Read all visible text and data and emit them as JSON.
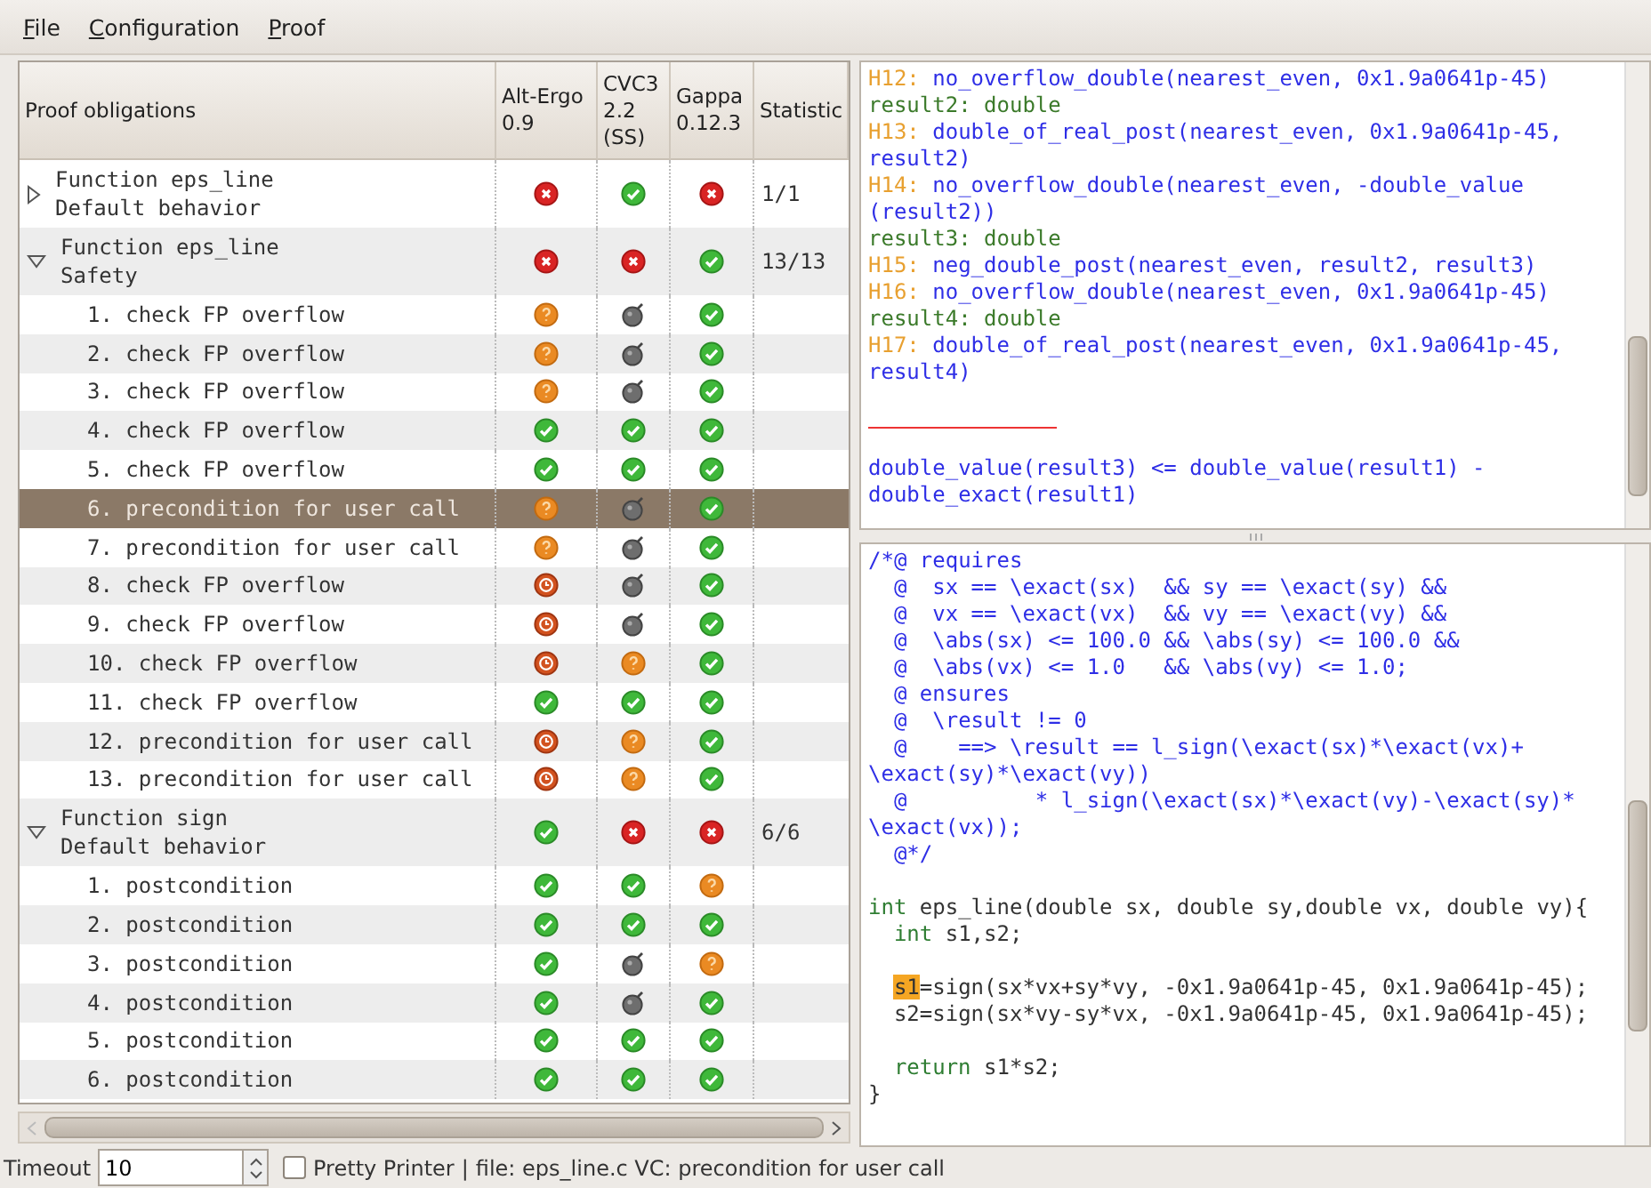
{
  "menu": [
    "File",
    "Configuration",
    "Proof"
  ],
  "tree": {
    "columns": [
      {
        "lines": [
          "Proof obligations"
        ]
      },
      {
        "lines": [
          "Alt-Ergo",
          "0.9"
        ]
      },
      {
        "lines": [
          "CVC3",
          "2.2",
          "(SS)"
        ]
      },
      {
        "lines": [
          "Gappa",
          "0.12.3"
        ]
      },
      {
        "lines": [
          "Statistic"
        ]
      }
    ],
    "groups": [
      {
        "label": [
          "Function eps_line",
          "Default behavior"
        ],
        "expanded": false,
        "selected": false,
        "results": [
          {
            "kind": "invalid"
          },
          {
            "kind": "valid"
          },
          {
            "kind": "invalid"
          }
        ],
        "statistic": "1/1"
      },
      {
        "label": [
          "Function eps_line",
          "Safety"
        ],
        "expanded": true,
        "selected": false,
        "results": [
          {
            "kind": "invalid"
          },
          {
            "kind": "invalid"
          },
          {
            "kind": "valid"
          }
        ],
        "statistic": "13/13",
        "children": [
          {
            "label": "1. check FP overflow",
            "selected": false,
            "results": [
              {
                "kind": "unknown"
              },
              {
                "kind": "error"
              },
              {
                "kind": "valid"
              }
            ]
          },
          {
            "label": "2. check FP overflow",
            "selected": false,
            "results": [
              {
                "kind": "unknown"
              },
              {
                "kind": "error"
              },
              {
                "kind": "valid"
              }
            ]
          },
          {
            "label": "3. check FP overflow",
            "selected": false,
            "results": [
              {
                "kind": "unknown"
              },
              {
                "kind": "error"
              },
              {
                "kind": "valid"
              }
            ]
          },
          {
            "label": "4. check FP overflow",
            "selected": false,
            "results": [
              {
                "kind": "valid"
              },
              {
                "kind": "valid"
              },
              {
                "kind": "valid"
              }
            ]
          },
          {
            "label": "5. check FP overflow",
            "selected": false,
            "results": [
              {
                "kind": "valid"
              },
              {
                "kind": "valid"
              },
              {
                "kind": "valid"
              }
            ]
          },
          {
            "label": "6. precondition for user call",
            "selected": true,
            "results": [
              {
                "kind": "unknown"
              },
              {
                "kind": "error"
              },
              {
                "kind": "valid"
              }
            ]
          },
          {
            "label": "7. precondition for user call",
            "selected": false,
            "results": [
              {
                "kind": "unknown"
              },
              {
                "kind": "error"
              },
              {
                "kind": "valid"
              }
            ]
          },
          {
            "label": "8. check FP overflow",
            "selected": false,
            "results": [
              {
                "kind": "timeout"
              },
              {
                "kind": "error"
              },
              {
                "kind": "valid"
              }
            ]
          },
          {
            "label": "9. check FP overflow",
            "selected": false,
            "results": [
              {
                "kind": "timeout"
              },
              {
                "kind": "error"
              },
              {
                "kind": "valid"
              }
            ]
          },
          {
            "label": "10. check FP overflow",
            "selected": false,
            "results": [
              {
                "kind": "timeout"
              },
              {
                "kind": "unknown"
              },
              {
                "kind": "valid"
              }
            ]
          },
          {
            "label": "11. check FP overflow",
            "selected": false,
            "results": [
              {
                "kind": "valid"
              },
              {
                "kind": "valid"
              },
              {
                "kind": "valid"
              }
            ]
          },
          {
            "label": "12. precondition for user call",
            "selected": false,
            "results": [
              {
                "kind": "timeout"
              },
              {
                "kind": "unknown"
              },
              {
                "kind": "valid"
              }
            ]
          },
          {
            "label": "13. precondition for user call",
            "selected": false,
            "results": [
              {
                "kind": "timeout"
              },
              {
                "kind": "unknown"
              },
              {
                "kind": "valid"
              }
            ]
          }
        ]
      },
      {
        "label": [
          "Function sign",
          "Default behavior"
        ],
        "expanded": true,
        "selected": false,
        "results": [
          {
            "kind": "valid"
          },
          {
            "kind": "invalid"
          },
          {
            "kind": "invalid"
          }
        ],
        "statistic": "6/6",
        "children": [
          {
            "label": "1. postcondition",
            "selected": false,
            "results": [
              {
                "kind": "valid"
              },
              {
                "kind": "valid"
              },
              {
                "kind": "unknown"
              }
            ]
          },
          {
            "label": "2. postcondition",
            "selected": false,
            "results": [
              {
                "kind": "valid"
              },
              {
                "kind": "valid"
              },
              {
                "kind": "valid"
              }
            ]
          },
          {
            "label": "3. postcondition",
            "selected": false,
            "results": [
              {
                "kind": "valid"
              },
              {
                "kind": "error"
              },
              {
                "kind": "unknown"
              }
            ]
          },
          {
            "label": "4. postcondition",
            "selected": false,
            "results": [
              {
                "kind": "valid"
              },
              {
                "kind": "error"
              },
              {
                "kind": "valid"
              }
            ]
          },
          {
            "label": "5. postcondition",
            "selected": false,
            "results": [
              {
                "kind": "valid"
              },
              {
                "kind": "valid"
              },
              {
                "kind": "valid"
              }
            ]
          },
          {
            "label": "6. postcondition",
            "selected": false,
            "results": [
              {
                "kind": "valid"
              },
              {
                "kind": "valid"
              },
              {
                "kind": "valid"
              }
            ]
          }
        ]
      }
    ]
  },
  "goal": [
    {
      "kind": "hyp",
      "label": "H12:",
      "text": " no_overflow_double(nearest_even, 0x1.9a0641p-45)"
    },
    {
      "kind": "var",
      "text": "result2: double"
    },
    {
      "kind": "hyp",
      "label": "H13:",
      "text": " double_of_real_post(nearest_even, 0x1.9a0641p-45,"
    },
    {
      "kind": "goal",
      "text": "result2)"
    },
    {
      "kind": "hyp",
      "label": "H14:",
      "text": " no_overflow_double(nearest_even, -double_value"
    },
    {
      "kind": "goal",
      "text": "(result2))"
    },
    {
      "kind": "var",
      "text": "result3: double"
    },
    {
      "kind": "hyp",
      "label": "H15:",
      "text": " neg_double_post(nearest_even, result2, result3)"
    },
    {
      "kind": "hyp",
      "label": "H16:",
      "text": " no_overflow_double(nearest_even, 0x1.9a0641p-45)"
    },
    {
      "kind": "var",
      "text": "result4: double"
    },
    {
      "kind": "hyp",
      "label": "H17:",
      "text": " double_of_real_post(nearest_even, 0x1.9a0641p-45,"
    },
    {
      "kind": "goal",
      "text": "result4)"
    },
    {
      "kind": "blank"
    },
    {
      "kind": "rule"
    },
    {
      "kind": "blank"
    },
    {
      "kind": "goal",
      "text": "double_value(result3) <= double_value(result1) -"
    },
    {
      "kind": "goal",
      "text": "double_exact(result1)"
    }
  ],
  "source": [
    {
      "kind": "text",
      "segments": [
        {
          "kind": "spec",
          "text": "/*@ requires"
        }
      ]
    },
    {
      "kind": "text",
      "segments": [
        {
          "kind": "spec",
          "text": "  @  sx == \\exact(sx)  && sy == \\exact(sy) &&"
        }
      ]
    },
    {
      "kind": "text",
      "segments": [
        {
          "kind": "spec",
          "text": "  @  vx == \\exact(vx)  && vy == \\exact(vy) &&"
        }
      ]
    },
    {
      "kind": "text",
      "segments": [
        {
          "kind": "spec",
          "text": "  @  \\abs(sx) <= 100.0 && \\abs(sy) <= 100.0 &&"
        }
      ]
    },
    {
      "kind": "text",
      "segments": [
        {
          "kind": "spec",
          "text": "  @  \\abs(vx) <= 1.0   && \\abs(vy) <= 1.0;"
        }
      ]
    },
    {
      "kind": "text",
      "segments": [
        {
          "kind": "spec",
          "text": "  @ ensures"
        }
      ]
    },
    {
      "kind": "text",
      "segments": [
        {
          "kind": "spec",
          "text": "  @  \\result != 0"
        }
      ]
    },
    {
      "kind": "text",
      "segments": [
        {
          "kind": "spec",
          "text": "  @    ==> \\result == l_sign(\\exact(sx)*\\exact(vx)+"
        }
      ]
    },
    {
      "kind": "text",
      "segments": [
        {
          "kind": "spec",
          "text": "\\exact(sy)*\\exact(vy))"
        }
      ]
    },
    {
      "kind": "text",
      "segments": [
        {
          "kind": "spec",
          "text": "  @          * l_sign(\\exact(sx)*\\exact(vy)-\\exact(sy)*"
        }
      ]
    },
    {
      "kind": "text",
      "segments": [
        {
          "kind": "spec",
          "text": "\\exact(vx));"
        }
      ]
    },
    {
      "kind": "text",
      "segments": [
        {
          "kind": "spec",
          "text": "  @*/"
        }
      ]
    },
    {
      "kind": "blank"
    },
    {
      "kind": "text",
      "segments": [
        {
          "kind": "keyword",
          "text": "int"
        },
        {
          "kind": "plain",
          "text": " eps_line(double sx, double sy,double vx, double vy){"
        }
      ]
    },
    {
      "kind": "text",
      "indent": true,
      "segments": [
        {
          "kind": "keyword",
          "text": "int"
        },
        {
          "kind": "plain",
          "text": " s1,s2;"
        }
      ]
    },
    {
      "kind": "blank"
    },
    {
      "kind": "text",
      "indent": true,
      "segments": [
        {
          "kind": "highlight",
          "text": "s1"
        },
        {
          "kind": "plain",
          "text": "=sign(sx*vx+sy*vy, -0x1.9a0641p-45, 0x1.9a0641p-45);"
        }
      ]
    },
    {
      "kind": "text",
      "segments": [
        {
          "kind": "plain",
          "text": "  s2=sign(sx*vy-sy*vx, -0x1.9a0641p-45, 0x1.9a0641p-45);"
        }
      ]
    },
    {
      "kind": "blank"
    },
    {
      "kind": "text",
      "indent": true,
      "segments": [
        {
          "kind": "keyword",
          "text": "return"
        },
        {
          "kind": "plain",
          "text": " s1*s2;"
        }
      ]
    },
    {
      "kind": "text",
      "segments": [
        {
          "kind": "plain",
          "text": "}"
        }
      ]
    }
  ],
  "status_bar": {
    "timeout_label": "Timeout",
    "timeout_value": "10",
    "pretty_printer": {
      "label": "Pretty Printer",
      "checked": false
    },
    "separator": "|",
    "message": "file: eps_line.c VC: precondition for user call"
  }
}
